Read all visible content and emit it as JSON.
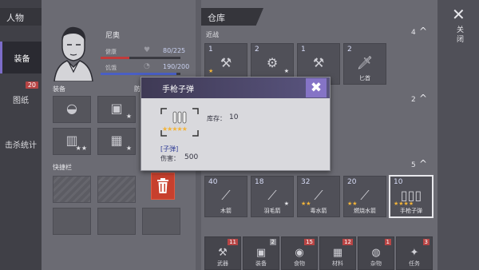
{
  "left_panel": {
    "title": "人物",
    "tabs": [
      {
        "label": "装备",
        "active": true
      },
      {
        "label": "图纸",
        "badge": "20"
      },
      {
        "label": "击杀统计"
      }
    ]
  },
  "character": {
    "name": "尼奥",
    "health_label": "健康",
    "health_value": "80/225",
    "health_fraction": 0.356,
    "food_label": "饥饿",
    "food_value": "190/200",
    "food_fraction": 0.95,
    "equipment_label": "装备",
    "defense_label": "防御",
    "quickbar_label": "快捷栏",
    "equipment_slots": [
      {
        "icon": "helmet-icon",
        "glyph": "◒",
        "star": ""
      },
      {
        "icon": "vest-icon",
        "glyph": "▣",
        "star": "★"
      },
      {
        "icon": "jacket-icon",
        "glyph": "▤",
        "star": ""
      },
      {
        "icon": "boots-icon",
        "glyph": "▥",
        "star": "★★"
      },
      {
        "icon": "pants-icon",
        "glyph": "▦",
        "star": "★"
      },
      {
        "icon": "shoes-icon",
        "glyph": "▧",
        "star": ""
      }
    ]
  },
  "inventory": {
    "title": "仓库",
    "categories": [
      {
        "label": "近战",
        "count": "4",
        "items": [
          {
            "count": "1",
            "icon": "chainsaw-icon",
            "glyph": "⚒",
            "name": "",
            "stars": "★",
            "wstars": ""
          },
          {
            "count": "2",
            "icon": "drill-icon",
            "glyph": "⚙",
            "name": "",
            "stars": "",
            "wstars": "★"
          },
          {
            "count": "1",
            "icon": "hammer-icon",
            "glyph": "⚒",
            "name": "",
            "stars": "",
            "wstars": ""
          },
          {
            "count": "2",
            "icon": "knife-icon",
            "glyph": "🗡",
            "name": "匕首",
            "stars": "",
            "wstars": ""
          }
        ]
      },
      {
        "label": "",
        "count": "2",
        "items": []
      },
      {
        "label": "",
        "count": "5",
        "items": [
          {
            "count": "40",
            "icon": "arrow-icon",
            "glyph": "⟋",
            "name": "木箭",
            "stars": "",
            "wstars": "",
            "selected": false
          },
          {
            "count": "18",
            "icon": "feather-arrow-icon",
            "glyph": "⟋",
            "name": "羽毛箭",
            "stars": "",
            "wstars": "★",
            "selected": false
          },
          {
            "count": "32",
            "icon": "poison-arrow-icon",
            "glyph": "⟋",
            "name": "毒水箭",
            "stars": "★★",
            "wstars": "",
            "selected": false
          },
          {
            "count": "20",
            "icon": "fire-arrow-icon",
            "glyph": "⟋",
            "name": "燃烧水箭",
            "stars": "★★",
            "wstars": "",
            "selected": false
          },
          {
            "count": "10",
            "icon": "bullets-icon",
            "glyph": "▯▯▯",
            "name": "手枪子弹",
            "stars": "★★★★",
            "wstars": "",
            "selected": true
          }
        ]
      }
    ],
    "bottom_tabs": [
      {
        "label": "武器",
        "badge": "11",
        "icon": "axe-icon",
        "glyph": "⚒",
        "gray": false
      },
      {
        "label": "装备",
        "badge": "2",
        "icon": "armor-icon",
        "glyph": "▣",
        "gray": true
      },
      {
        "label": "食物",
        "badge": "15",
        "icon": "food-icon",
        "glyph": "◉",
        "gray": false
      },
      {
        "label": "材料",
        "badge": "12",
        "icon": "material-icon",
        "glyph": "▦",
        "gray": false
      },
      {
        "label": "杂物",
        "badge": "1",
        "icon": "bag-icon",
        "glyph": "◍",
        "gray": false
      },
      {
        "label": "任务",
        "badge": "3",
        "icon": "quest-icon",
        "glyph": "✦",
        "gray": false
      }
    ]
  },
  "popup": {
    "title": "手枪子弹",
    "stock_label": "库存：",
    "stock_value": "10",
    "item_name": "[子弹]",
    "damage_label": "伤害：",
    "damage_value": "500",
    "stars": "★★★★★"
  },
  "close": {
    "label": "关闭"
  },
  "colors": {
    "accent": "#8574c6",
    "health_bar": "#c23b3b",
    "food_bar": "#4a5fc4",
    "star": "#f2b43a",
    "trash": "#c7402e"
  }
}
